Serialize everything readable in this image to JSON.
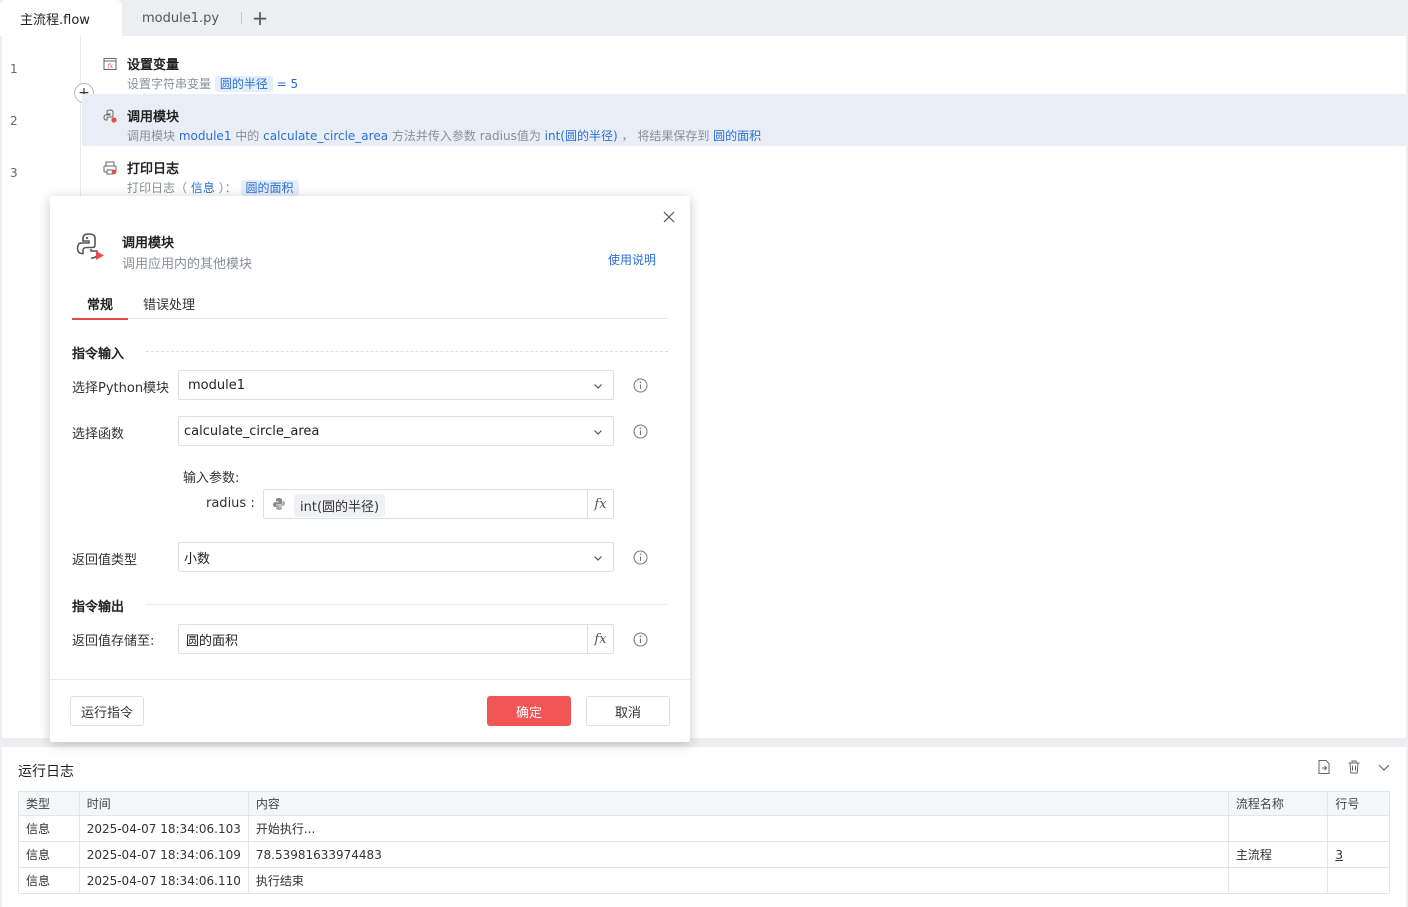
{
  "tabs": [
    {
      "label": "主流程.flow",
      "active": true
    },
    {
      "label": "module1.py",
      "active": false
    }
  ],
  "editor": {
    "steps": [
      {
        "line": "1",
        "title": "设置变量",
        "desc_prefix": "设置字符串变量",
        "var": "圆的半径",
        "eq": "= 5"
      },
      {
        "line": "2",
        "title": "调用模块",
        "d1": "调用模块",
        "module": "module1",
        "d2": "中的",
        "func": "calculate_circle_area",
        "d3": "方法并传入参数 radius值为",
        "arg": "int(圆的半径)",
        "d4": "，  将结果保存到",
        "result": "圆的面积"
      },
      {
        "line": "3",
        "title": "打印日志",
        "d1": "打印日志（",
        "level": "信息",
        "d2": "）：",
        "var": "圆的面积"
      }
    ]
  },
  "modal": {
    "title": "调用模块",
    "subtitle": "调用应用内的其他模块",
    "help": "使用说明",
    "tabs": [
      "常规",
      "错误处理"
    ],
    "section_input": "指令输入",
    "module_label": "选择Python模块",
    "module_value": "module1",
    "func_label": "选择函数",
    "func_value": "calculate_circle_area",
    "params_head": "输入参数:",
    "param_name": "radius :",
    "param_value": "int(圆的半径)",
    "return_type_label": "返回值类型",
    "return_type_value": "小数",
    "section_output": "指令输出",
    "save_label": "返回值存储至:",
    "save_value": "圆的面积",
    "run_label": "运行指令",
    "ok_label": "确定",
    "cancel_label": "取消"
  },
  "log": {
    "title": "运行日志",
    "columns": [
      "类型",
      "时间",
      "内容",
      "流程名称",
      "行号"
    ],
    "rows": [
      [
        "信息",
        "2025-04-07 18:34:06.103",
        "开始执行...",
        "",
        ""
      ],
      [
        "信息",
        "2025-04-07 18:34:06.109",
        "78.53981633974483",
        "主流程",
        "3"
      ],
      [
        "信息",
        "2025-04-07 18:34:06.110",
        "执行结束",
        "",
        ""
      ]
    ]
  },
  "colors": {
    "accent": "#2a6fd6",
    "primary_button": "#f25555",
    "tab_indicator": "#e84a4a"
  },
  "icons": [
    "fx-icon",
    "python-module-icon",
    "print-icon",
    "close-icon",
    "info-icon",
    "chevron-down-icon",
    "export-icon",
    "trash-icon",
    "collapse-icon",
    "plus-icon"
  ]
}
